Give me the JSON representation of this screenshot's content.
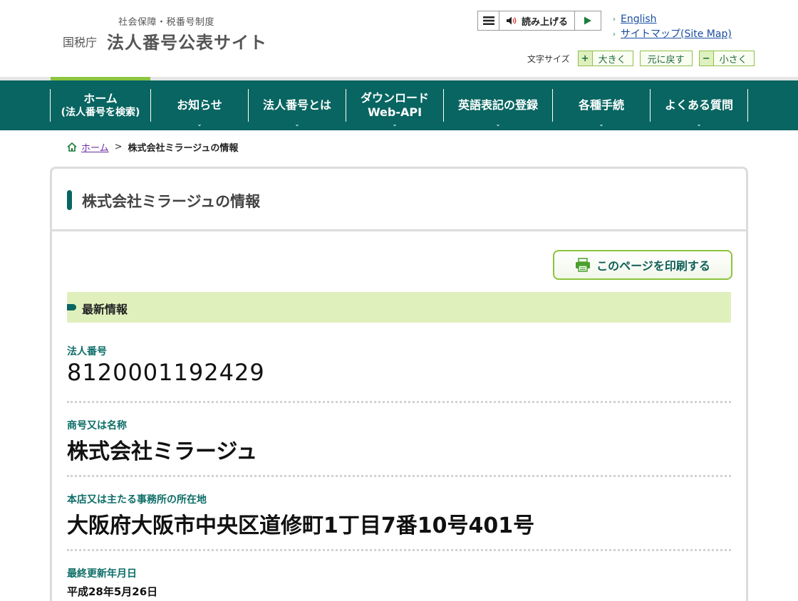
{
  "header": {
    "logo_sub": "社会保障・税番号制度",
    "logo_agency": "国税庁",
    "logo_main": "法人番号公表サイト",
    "readbar": {
      "read_label": "読み上げる"
    },
    "links": [
      {
        "label": "English"
      },
      {
        "label": "サイトマップ(Site Map)"
      }
    ],
    "fontsize": {
      "label": "文字サイズ",
      "larger": "大きく",
      "reset": "元に戻す",
      "smaller": "小さく",
      "plus_symbol": "+",
      "minus_symbol": "−"
    }
  },
  "nav": {
    "items": [
      {
        "line1": "ホーム",
        "line2": "(法人番号を検索)",
        "has_dropdown": false
      },
      {
        "line1": "お知らせ",
        "line2": "",
        "has_dropdown": true
      },
      {
        "line1": "法人番号とは",
        "line2": "",
        "has_dropdown": true
      },
      {
        "line1": "ダウンロード",
        "line2": "Web-API",
        "has_dropdown": true
      },
      {
        "line1": "英語表記の登録",
        "line2": "",
        "has_dropdown": true
      },
      {
        "line1": "各種手続",
        "line2": "",
        "has_dropdown": true
      },
      {
        "line1": "よくある質問",
        "line2": "",
        "has_dropdown": true
      }
    ]
  },
  "breadcrumb": {
    "home": "ホーム",
    "separator": ">",
    "current": "株式会社ミラージュの情報"
  },
  "main": {
    "title": "株式会社ミラージュの情報",
    "print_label": "このページを印刷する",
    "section_title": "最新情報",
    "fields": [
      {
        "label": "法人番号",
        "value": "8120001192429"
      },
      {
        "label": "商号又は名称",
        "value": "株式会社ミラージュ"
      },
      {
        "label": "本店又は主たる事務所の所在地",
        "value": "大阪府大阪市中央区道修町1丁目7番10号401号"
      },
      {
        "label": "最終更新年月日",
        "value": "平成28年5月26日"
      }
    ]
  },
  "colors": {
    "nav_bg": "#086561",
    "accent_green": "#8cc43e",
    "section_bg": "#e0f0bc",
    "label_teal": "#0e6e68",
    "link_blue": "#1a4ea0"
  },
  "icons": {
    "menu": "menu-icon",
    "speaker": "speaker-icon",
    "play": "play-icon",
    "home": "home-icon",
    "printer": "printer-icon"
  }
}
